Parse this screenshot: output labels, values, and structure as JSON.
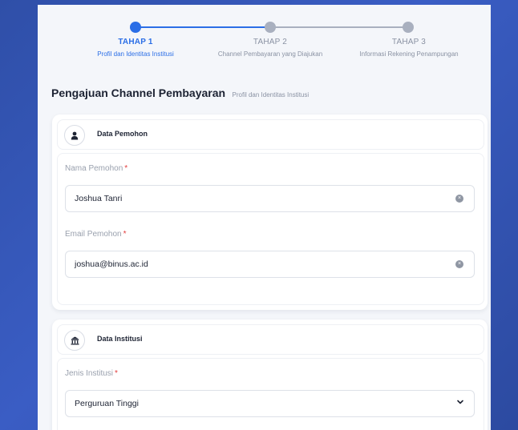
{
  "stepper": {
    "steps": [
      {
        "title": "TAHAP 1",
        "subtitle": "Profil dan Identitas Institusi",
        "active": true
      },
      {
        "title": "TAHAP 2",
        "subtitle": "Channel Pembayaran yang Diajukan",
        "active": false
      },
      {
        "title": "TAHAP 3",
        "subtitle": "Informasi Rekening Penampungan",
        "active": false
      }
    ]
  },
  "page": {
    "title": "Pengajuan Channel Pembayaran",
    "subtitle": "Profil dan Identitas Institusi"
  },
  "applicant_section": {
    "title": "Data Pemohon",
    "icon": "person-icon",
    "fields": [
      {
        "label": "Nama Pemohon",
        "required": "*",
        "value": "Joshua Tanri"
      },
      {
        "label": "Email Pemohon",
        "required": "*",
        "value": "joshua@binus.ac.id"
      }
    ]
  },
  "institution_section": {
    "title": "Data Institusi",
    "icon": "institution-building-icon",
    "fields": [
      {
        "label": "Jenis Institusi",
        "required": "*",
        "value": "Perguruan Tinggi"
      }
    ]
  },
  "colors": {
    "accent": "#2b6ee6",
    "inactive": "#a9b0bf",
    "required": "#e23b3b",
    "background": "#3a5dc4"
  }
}
